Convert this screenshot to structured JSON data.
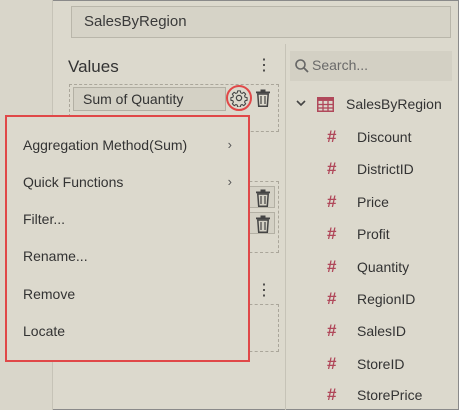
{
  "dataset_title": "SalesByRegion",
  "values_panel": {
    "title": "Values",
    "chip_label": "Sum of Quantity"
  },
  "search": {
    "placeholder": "Search..."
  },
  "tree": {
    "root_label": "SalesByRegion",
    "fields": [
      "Discount",
      "DistrictID",
      "Price",
      "Profit",
      "Quantity",
      "RegionID",
      "SalesID",
      "StoreID",
      "StorePrice"
    ]
  },
  "context_menu": {
    "items": [
      {
        "label": "Aggregation Method(Sum)",
        "has_submenu": true
      },
      {
        "label": "Quick Functions",
        "has_submenu": true
      },
      {
        "label": "Filter...",
        "has_submenu": false
      },
      {
        "label": "Rename...",
        "has_submenu": false
      },
      {
        "label": "Remove",
        "has_submenu": false
      },
      {
        "label": "Locate",
        "has_submenu": false
      }
    ]
  },
  "colors": {
    "highlight": "#e04848",
    "field_icon": "#b0485a",
    "table_icon": "#b0485a"
  }
}
